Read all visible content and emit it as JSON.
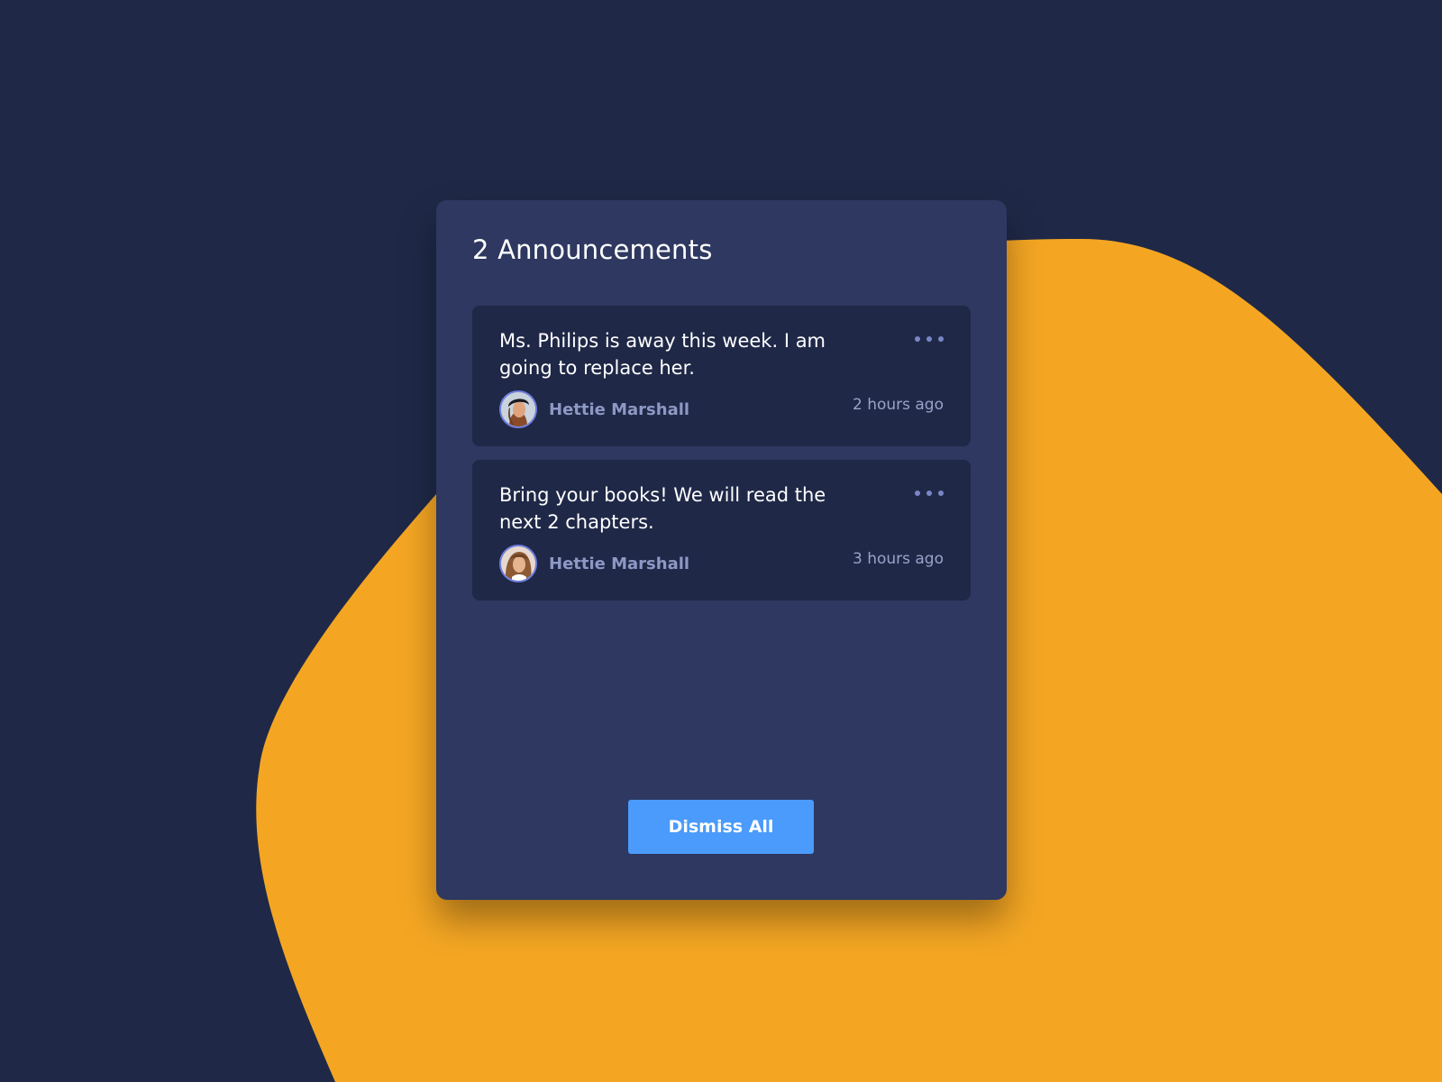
{
  "colors": {
    "background": "#1f2947",
    "blob": "#f4a623",
    "panel": "#2e3860",
    "card": "#1f2847",
    "accent_button": "#4a9bfb",
    "author_name": "#8e98c4",
    "timestamp": "#9aa3c8",
    "more_dots": "#7b86c8",
    "avatar_ring": "#6f7fe0"
  },
  "panel": {
    "title": "2 Announcements",
    "announcements": [
      {
        "message": "Ms. Philips is away this week. I am going to replace her.",
        "author": "Hettie Marshall",
        "time": "2 hours ago",
        "avatar_icon": "avatar-photo",
        "menu_icon": "more-horizontal-icon"
      },
      {
        "message": "Bring your books! We will read the next 2 chapters.",
        "author": "Hettie Marshall",
        "time": "3 hours ago",
        "avatar_icon": "avatar-photo",
        "menu_icon": "more-horizontal-icon"
      }
    ],
    "dismiss_label": "Dismiss All"
  }
}
